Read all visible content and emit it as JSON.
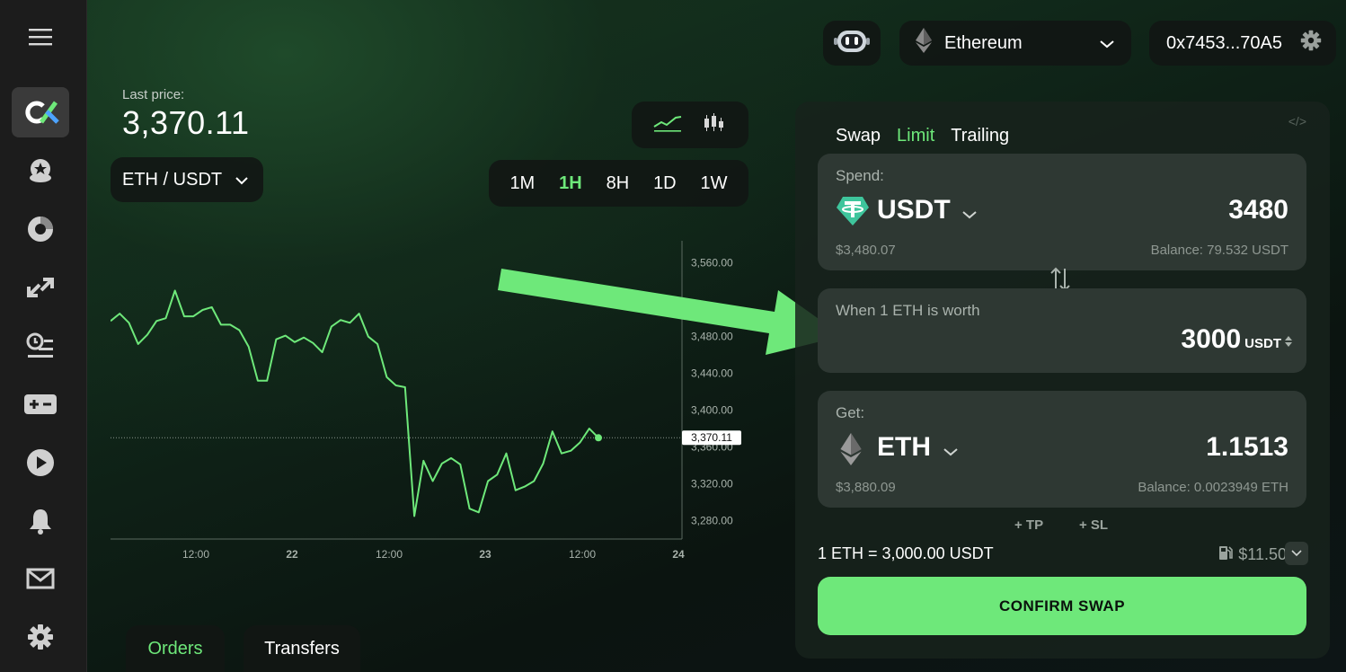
{
  "sidebar": {
    "icons": [
      "menu-icon",
      "logo-icon",
      "star-coin-icon",
      "donut-chart-icon",
      "swap-arrows-icon",
      "history-list-icon",
      "plus-minus-icon",
      "play-icon",
      "bell-icon",
      "mail-icon",
      "settings-gear-icon"
    ]
  },
  "header": {
    "network": "Ethereum",
    "wallet_address": "0x7453...70A5"
  },
  "market": {
    "last_price_label": "Last price:",
    "last_price": "3,370.11",
    "pair": "ETH / USDT",
    "timeframes": [
      "1M",
      "1H",
      "8H",
      "1D",
      "1W"
    ],
    "active_timeframe": "1H"
  },
  "chart_data": {
    "type": "line",
    "y_ticks": [
      "3,560.00",
      "3,480.00",
      "3,440.00",
      "3,400.00",
      "3,360.00",
      "3,320.00",
      "3,280.00"
    ],
    "x_ticks": [
      "12:00",
      "22",
      "12:00",
      "23",
      "12:00",
      "24"
    ],
    "current_label": "3,370.11",
    "current_value": 3370.11,
    "ylim": [
      3260,
      3590
    ],
    "values": [
      3497,
      3505,
      3495,
      3472,
      3482,
      3497,
      3500,
      3530,
      3502,
      3502,
      3509,
      3512,
      3493,
      3493,
      3487,
      3469,
      3432,
      3432,
      3477,
      3481,
      3474,
      3479,
      3473,
      3463,
      3491,
      3498,
      3495,
      3505,
      3480,
      3472,
      3436,
      3427,
      3425,
      3285,
      3345,
      3323,
      3342,
      3348,
      3341,
      3293,
      3289,
      3323,
      3330,
      3353,
      3313,
      3317,
      3323,
      3342,
      3377,
      3353,
      3356,
      3365,
      3380,
      3370
    ]
  },
  "bottom_tabs": {
    "orders": "Orders",
    "transfers": "Transfers"
  },
  "swap": {
    "tabs": [
      "Swap",
      "Limit",
      "Trailing"
    ],
    "active_tab": "Limit",
    "embed_label": "</>",
    "spend": {
      "label": "Spend:",
      "token": "USDT",
      "amount": "3480",
      "usd_value": "$3,480.07",
      "balance": "Balance: 79.532 USDT"
    },
    "limit": {
      "label": "When 1 ETH is worth",
      "amount": "3000",
      "unit": "USDT"
    },
    "get": {
      "label": "Get:",
      "token": "ETH",
      "amount": "1.1513",
      "usd_value": "$3,880.09",
      "balance": "Balance: 0.0023949 ETH"
    },
    "tp": "+ TP",
    "sl": "+ SL",
    "rate": "1 ETH = 3,000.00 USDT",
    "gas": "$11.50",
    "confirm": "CONFIRM SWAP"
  },
  "colors": {
    "accent": "#6ee87a",
    "tether": "#3ec59c"
  }
}
